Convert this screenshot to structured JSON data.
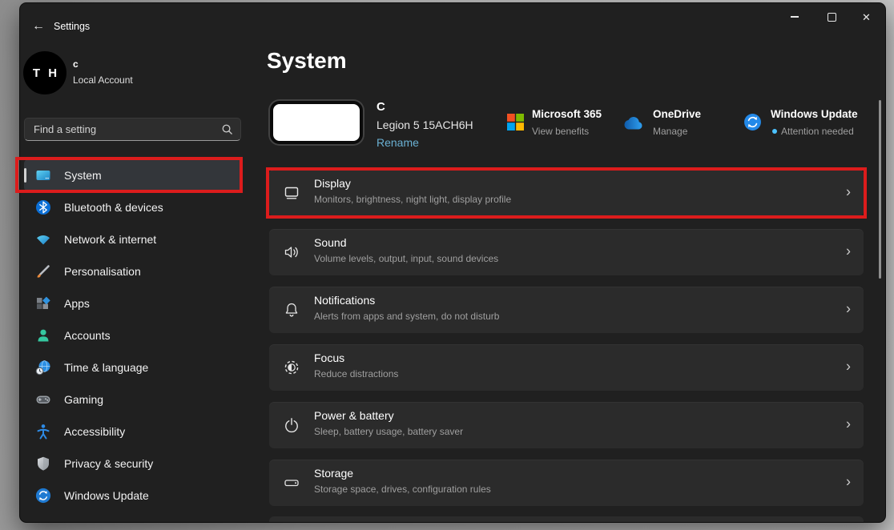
{
  "titlebar": {
    "title": "Settings"
  },
  "account": {
    "initials": "T H",
    "name": "c",
    "type": "Local Account"
  },
  "search": {
    "placeholder": "Find a setting"
  },
  "sidebar": {
    "items": [
      {
        "label": "System",
        "icon": "system-icon",
        "selected": true
      },
      {
        "label": "Bluetooth & devices",
        "icon": "bluetooth-icon",
        "selected": false
      },
      {
        "label": "Network & internet",
        "icon": "network-icon",
        "selected": false
      },
      {
        "label": "Personalisation",
        "icon": "personalisation-icon",
        "selected": false
      },
      {
        "label": "Apps",
        "icon": "apps-icon",
        "selected": false
      },
      {
        "label": "Accounts",
        "icon": "accounts-icon",
        "selected": false
      },
      {
        "label": "Time & language",
        "icon": "time-language-icon",
        "selected": false
      },
      {
        "label": "Gaming",
        "icon": "gaming-icon",
        "selected": false
      },
      {
        "label": "Accessibility",
        "icon": "accessibility-icon",
        "selected": false
      },
      {
        "label": "Privacy & security",
        "icon": "privacy-icon",
        "selected": false
      },
      {
        "label": "Windows Update",
        "icon": "windows-update-icon",
        "selected": false
      }
    ]
  },
  "main": {
    "page_title": "System",
    "device": {
      "name": "C",
      "model": "Legion 5 15ACH6H",
      "rename_label": "Rename"
    },
    "quick_links": [
      {
        "title": "Microsoft 365",
        "subtitle": "View benefits",
        "icon": "microsoft-logo"
      },
      {
        "title": "OneDrive",
        "subtitle": "Manage",
        "icon": "onedrive-cloud-icon"
      },
      {
        "title": "Windows Update",
        "subtitle": "Attention needed",
        "icon": "windows-update-icon",
        "status_dot": true
      }
    ],
    "rows": [
      {
        "title": "Display",
        "subtitle": "Monitors, brightness, night light, display profile",
        "icon": "display-icon",
        "annotated": true
      },
      {
        "title": "Sound",
        "subtitle": "Volume levels, output, input, sound devices",
        "icon": "sound-icon",
        "annotated": false
      },
      {
        "title": "Notifications",
        "subtitle": "Alerts from apps and system, do not disturb",
        "icon": "notifications-icon",
        "annotated": false
      },
      {
        "title": "Focus",
        "subtitle": "Reduce distractions",
        "icon": "focus-icon",
        "annotated": false
      },
      {
        "title": "Power & battery",
        "subtitle": "Sleep, battery usage, battery saver",
        "icon": "power-icon",
        "annotated": false
      },
      {
        "title": "Storage",
        "subtitle": "Storage space, drives, configuration rules",
        "icon": "storage-icon",
        "annotated": false
      }
    ]
  },
  "ui": {
    "back_glyph": "←",
    "close_glyph": "✕",
    "chevron_glyph": "›"
  },
  "colors": {
    "annotation_red": "#dc1c1c",
    "link_blue": "#6ab0d2",
    "attention_dot_blue": "#4cc2ff",
    "window_bg": "#202020",
    "card_bg": "#2b2b2b"
  }
}
